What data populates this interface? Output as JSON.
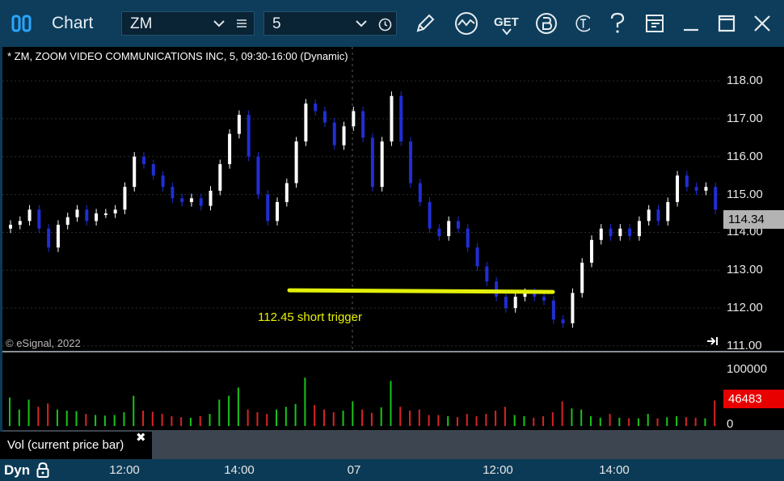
{
  "titlebar": {
    "app_title": "Chart",
    "symbol": "ZM",
    "interval": "5",
    "icons": [
      "app-logo-icon",
      "chevron-down-icon",
      "list-icon",
      "chevron-down-icon",
      "clock-icon",
      "pencil-icon",
      "study-icon",
      "get-icon",
      "b-badge-icon",
      "t-badge-icon",
      "help-icon",
      "layout-icon",
      "minimize-icon",
      "maximize-icon",
      "close-icon"
    ],
    "get_label": "GET"
  },
  "chart": {
    "header": "* ZM, ZOOM VIDEO COMMUNICATIONS INC, 5, 09:30-16:00 (Dynamic)",
    "copyright": "© eSignal, 2022",
    "annotation": "112.45 short trigger",
    "current_price": "114.34",
    "current_volume": "46483",
    "colors": {
      "up": "#ffffff",
      "down": "#1f2ed6",
      "price_tag": "#b3b3b3",
      "vol_tag": "#e80000",
      "trigger_line": "#e2f00a",
      "vol_up": "#19c419",
      "vol_down": "#d92424"
    }
  },
  "chart_data": {
    "type": "candlestick",
    "title": "* ZM, ZOOM VIDEO COMMUNICATIONS INC, 5, 09:30-16:00 (Dynamic)",
    "y_ticks": [
      "118.00",
      "117.00",
      "116.00",
      "115.00",
      "114.00",
      "113.00",
      "112.00",
      "111.00"
    ],
    "ylim": [
      111.0,
      118.6
    ],
    "vol_ticks": [
      "100000",
      "0"
    ],
    "x_ticks": [
      "12:00",
      "14:00",
      "07",
      "12:00",
      "14:00"
    ],
    "last_price": 114.34,
    "last_volume": 46483,
    "trigger_level": 112.45,
    "closes": [
      114.2,
      114.3,
      114.6,
      114.1,
      113.6,
      114.2,
      114.4,
      114.6,
      114.3,
      114.5,
      114.5,
      114.6,
      115.2,
      116.0,
      115.8,
      115.5,
      115.2,
      114.9,
      114.8,
      114.9,
      114.7,
      115.1,
      115.8,
      116.6,
      117.1,
      116.0,
      115.0,
      114.3,
      114.8,
      115.3,
      116.4,
      117.4,
      117.2,
      116.9,
      116.3,
      116.8,
      117.2,
      116.5,
      115.2,
      116.4,
      117.6,
      116.4,
      115.3,
      114.8,
      114.1,
      113.9,
      114.3,
      114.1,
      113.6,
      113.1,
      112.7,
      112.3,
      112.0,
      112.3,
      112.4,
      112.3,
      112.2,
      111.7,
      111.6,
      112.4,
      113.2,
      113.8,
      114.1,
      113.9,
      114.1,
      113.9,
      114.3,
      114.6,
      114.3,
      114.8,
      115.5,
      115.2,
      115.1,
      115.2,
      114.6
    ],
    "volumes": [
      52000,
      30000,
      48000,
      35000,
      41000,
      30000,
      28000,
      27000,
      22000,
      20000,
      19000,
      20000,
      25000,
      55000,
      28000,
      26000,
      22000,
      18000,
      16000,
      15000,
      18000,
      22000,
      48000,
      55000,
      70000,
      30000,
      25000,
      22000,
      30000,
      35000,
      40000,
      88000,
      38000,
      30000,
      25000,
      28000,
      45000,
      30000,
      24000,
      34000,
      82000,
      35000,
      28000,
      30000,
      20000,
      20000,
      18000,
      16000,
      22000,
      18000,
      22000,
      28000,
      35000,
      20000,
      18000,
      15000,
      18000,
      25000,
      45000,
      32000,
      30000,
      18000,
      15000,
      22000,
      15000,
      14000,
      14000,
      22000,
      14000,
      16000,
      18000,
      16000,
      15000,
      14000,
      46483
    ]
  },
  "volume_panel": {
    "label": "Vol (current price bar)",
    "close_glyph": "✖"
  },
  "timeaxis": {
    "dyn_label": "Dyn",
    "ticks": [
      "12:00",
      "14:00",
      "07",
      "12:00",
      "14:00"
    ]
  }
}
